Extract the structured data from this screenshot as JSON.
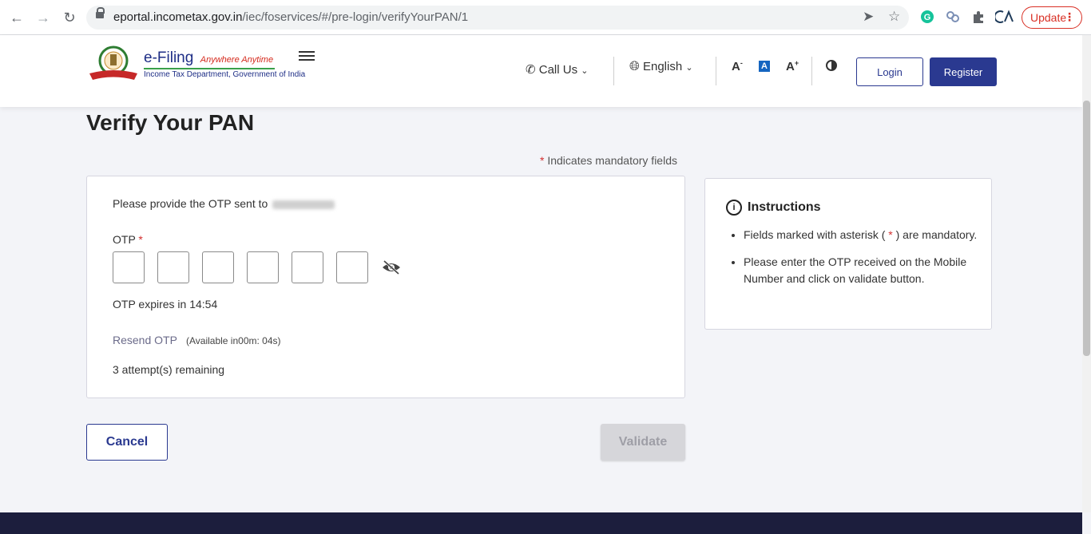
{
  "browser": {
    "url_host": "eportal.incometax.gov.in",
    "url_path": "/iec/foservices/#/pre-login/verifyYourPAN/1",
    "update_label": "Update"
  },
  "header": {
    "brand_title": "e-Filing",
    "brand_tagline": "Anywhere Anytime",
    "brand_subtitle": "Income Tax Department, Government of India",
    "call_us": "Call Us",
    "language": "English",
    "font_decrease": "A",
    "font_normal": "A",
    "font_increase": "A",
    "login": "Login",
    "register": "Register"
  },
  "page": {
    "title": "Verify Your PAN",
    "mandatory_asterisk": "*",
    "mandatory_note": "Indicates mandatory fields"
  },
  "otp_card": {
    "provide_text": "Please provide the OTP sent to",
    "otp_label": "OTP",
    "otp_required": "*",
    "boxes": [
      "",
      "",
      "",
      "",
      "",
      ""
    ],
    "expires": "OTP expires in 14:54",
    "resend": "Resend OTP",
    "available": "(Available in00m: 04s)",
    "attempts": "3 attempt(s) remaining"
  },
  "actions": {
    "cancel": "Cancel",
    "validate": "Validate"
  },
  "instructions": {
    "title": "Instructions",
    "item1_pre": "Fields marked with asterisk (",
    "item1_star": "*",
    "item1_post": ") are mandatory.",
    "item2": "Please enter the OTP received on the Mobile Number and click on validate button."
  },
  "colors": {
    "primary": "#2a3990",
    "required": "#d32f2f",
    "footer": "#1c1e3d"
  }
}
